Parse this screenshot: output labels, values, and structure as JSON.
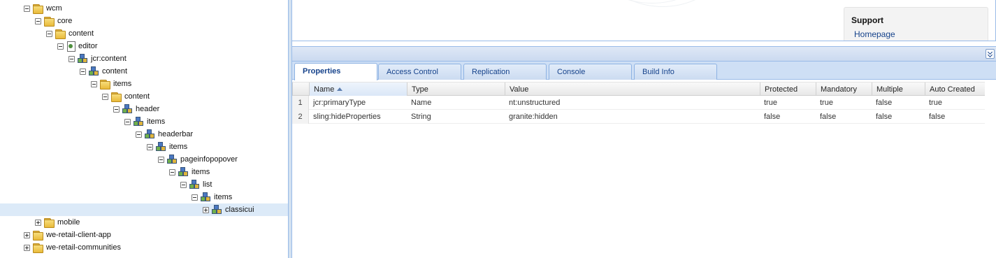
{
  "tree": {
    "nodes": [
      {
        "label": "wcm",
        "toggle": "minus",
        "icon": "folder",
        "selected": false
      },
      {
        "label": "core",
        "toggle": "minus",
        "icon": "folder",
        "selected": false
      },
      {
        "label": "content",
        "toggle": "minus",
        "icon": "folder",
        "selected": false
      },
      {
        "label": "editor",
        "toggle": "minus",
        "icon": "page",
        "selected": false
      },
      {
        "label": "jcr:content",
        "toggle": "minus",
        "icon": "component",
        "selected": false
      },
      {
        "label": "content",
        "toggle": "minus",
        "icon": "component",
        "selected": false
      },
      {
        "label": "items",
        "toggle": "minus",
        "icon": "folder",
        "selected": false
      },
      {
        "label": "content",
        "toggle": "minus",
        "icon": "folder",
        "selected": false
      },
      {
        "label": "header",
        "toggle": "minus",
        "icon": "component",
        "selected": false
      },
      {
        "label": "items",
        "toggle": "minus",
        "icon": "component",
        "selected": false
      },
      {
        "label": "headerbar",
        "toggle": "minus",
        "icon": "component",
        "selected": false
      },
      {
        "label": "items",
        "toggle": "minus",
        "icon": "component",
        "selected": false
      },
      {
        "label": "pageinfopopover",
        "toggle": "minus",
        "icon": "component",
        "selected": false
      },
      {
        "label": "items",
        "toggle": "minus",
        "icon": "component",
        "selected": false
      },
      {
        "label": "list",
        "toggle": "minus",
        "icon": "component",
        "selected": false
      },
      {
        "label": "items",
        "toggle": "minus",
        "icon": "component",
        "selected": false
      },
      {
        "label": "classicui",
        "toggle": "plus",
        "icon": "component",
        "selected": true
      },
      {
        "label": "mobile",
        "toggle": "plus",
        "icon": "folder",
        "selected": false
      },
      {
        "label": "we-retail-client-app",
        "toggle": "plus",
        "icon": "folder",
        "selected": false
      },
      {
        "label": "we-retail-communities",
        "toggle": "plus",
        "icon": "folder",
        "selected": false
      }
    ]
  },
  "support": {
    "title": "Support",
    "link": "Homepage"
  },
  "tabs": [
    {
      "label": "Properties",
      "active": true
    },
    {
      "label": "Access Control",
      "active": false
    },
    {
      "label": "Replication",
      "active": false
    },
    {
      "label": "Console",
      "active": false
    },
    {
      "label": "Build Info",
      "active": false
    }
  ],
  "grid": {
    "columns": [
      "",
      "Name",
      "Type",
      "Value",
      "Protected",
      "Mandatory",
      "Multiple",
      "Auto Created"
    ],
    "sorted_column": "Name",
    "sort_direction": "ascending",
    "rows": [
      [
        "1",
        "jcr:primaryType",
        "Name",
        "nt:unstructured",
        "true",
        "true",
        "false",
        "true"
      ],
      [
        "2",
        "sling:hideProperties",
        "String",
        "granite:hidden",
        "false",
        "false",
        "false",
        "false"
      ]
    ]
  },
  "colors": {
    "accent": "#15428b",
    "panel_border": "#99bbe8",
    "selection": "#dceaf8"
  }
}
